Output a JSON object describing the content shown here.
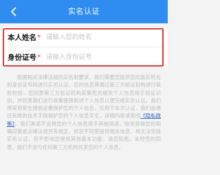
{
  "header": {
    "title": "实名认证",
    "back_icon": "chevron-left-icon"
  },
  "form": {
    "name_label": "本人姓名",
    "name_required": "*",
    "name_placeholder": "请输入您的姓名",
    "name_value": "",
    "id_label": "身份证号",
    "id_required": "*",
    "id_placeholder": "请输入身份证号",
    "id_value": ""
  },
  "notice": {
    "text_before": "根据相关法律法规的实名制要求，我们需要您提供您的真实姓名和身份证号码进行实名认证，您的信息将通过第三方验证机构进行核验校验，您同意第三方验证机构采集您的相关个人信息用于验证识别，并同意我们进行收集使用前述个人信息以便完成实名认证。我们将采用安全措施妥善保护您的个人信息，仅用于本次认证，我们会通过有效的技术手段保护您的个人信息安全，详细内容请查阅",
    "link_text": "《隐私政策》",
    "text_after": "。我们承诺不会将您的个人信息用于其他用途，除非获得您的明确同意或法律法规另有规定。如您不同意提供相关信息，将无法完成实名认证，但不影响您使用其他基本功能，请您知悉。未经您的同意，我们不会与任何第三方机构共享您的个人信息。"
  },
  "colors": {
    "header_bg": "#2f8cf0",
    "highlight_border": "#e03c3c",
    "link": "#2f62c8"
  }
}
